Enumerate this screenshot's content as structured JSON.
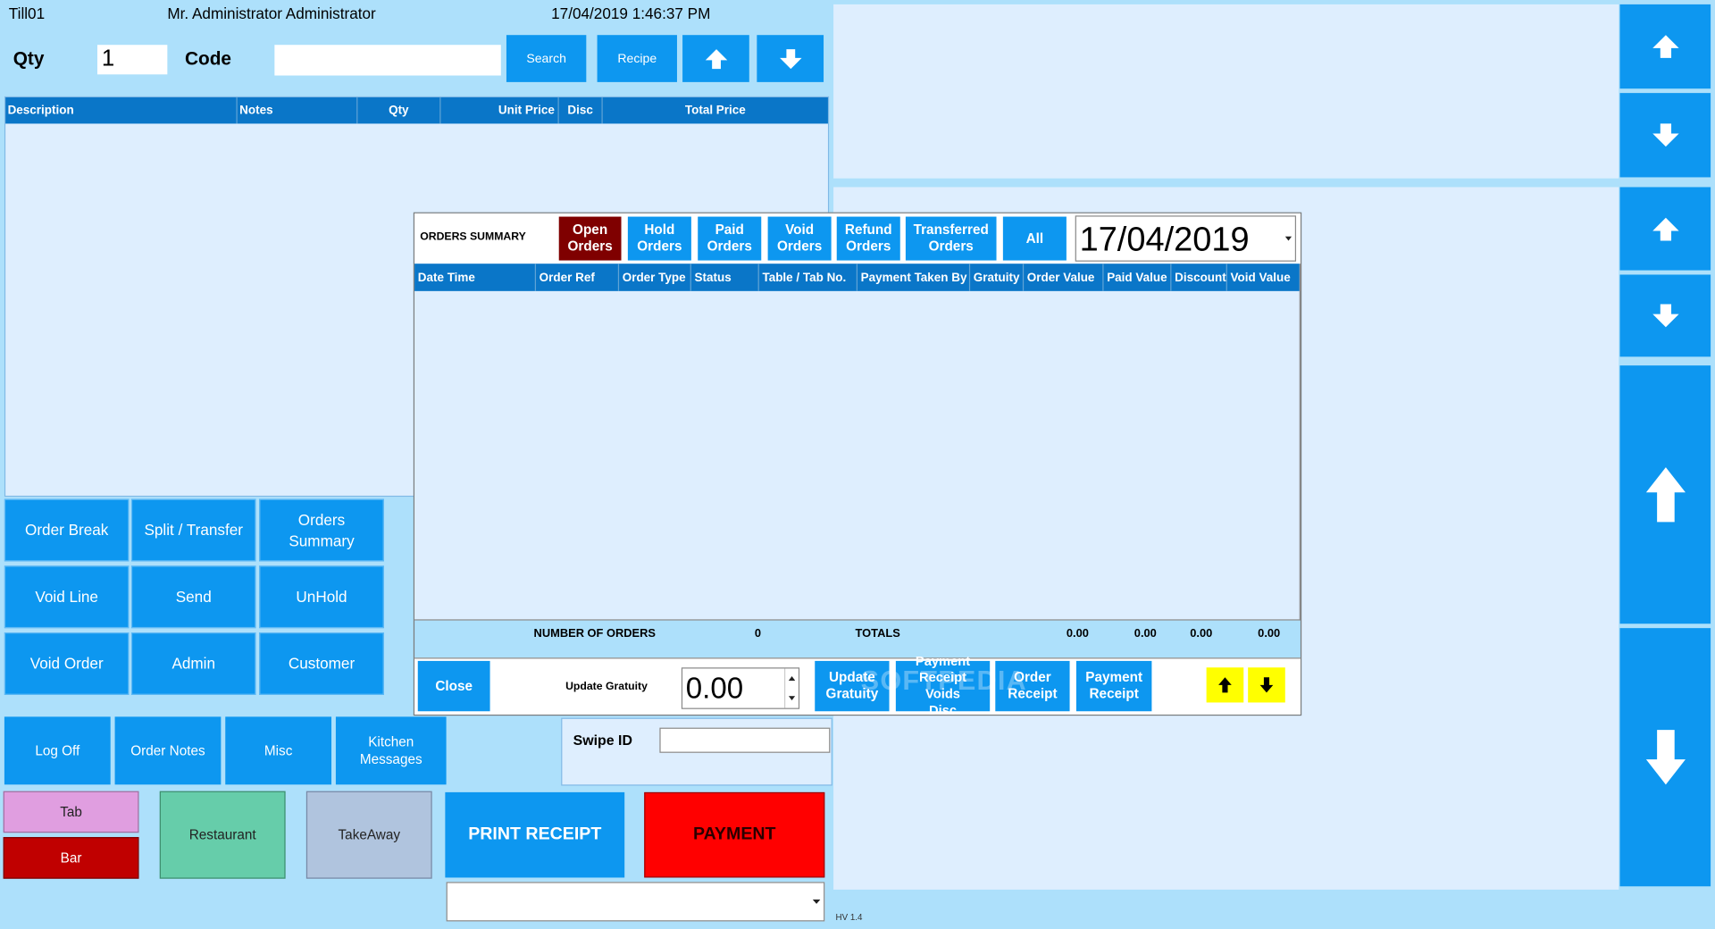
{
  "header": {
    "till": "Till01",
    "user": "Mr. Administrator Administrator",
    "datetime": "17/04/2019 1:46:37 PM"
  },
  "entry": {
    "qty_label": "Qty",
    "qty_value": "1",
    "code_label": "Code",
    "code_value": "",
    "search_label": "Search",
    "recipe_label": "Recipe"
  },
  "order_columns": [
    "Description",
    "Notes",
    "Qty",
    "Unit Price",
    "Disc",
    "Total Price"
  ],
  "function_buttons": {
    "order_break": "Order Break",
    "split_transfer": "Split / Transfer",
    "orders_summary": "Orders Summary",
    "void_line": "Void Line",
    "send": "Send",
    "unhold": "UnHold",
    "void_order": "Void Order",
    "admin": "Admin",
    "customer": "Customer"
  },
  "bottom_buttons": {
    "log_off": "Log Off",
    "order_notes": "Order Notes",
    "misc": "Misc",
    "kitchen_messages": "Kitchen Messages",
    "tab": "Tab",
    "bar": "Bar",
    "restaurant": "Restaurant",
    "takeaway": "TakeAway",
    "print_receipt": "PRINT RECEIPT",
    "payment": "PAYMENT"
  },
  "swipe": {
    "label": "Swipe ID",
    "value": ""
  },
  "bottom_select": {
    "value": ""
  },
  "version": "HV 1.4",
  "orders_summary": {
    "title": "ORDERS SUMMARY",
    "filters": [
      "Open Orders",
      "Hold Orders",
      "Paid Orders",
      "Void Orders",
      "Refund Orders",
      "Transferred Orders",
      "All"
    ],
    "active_filter": "Open Orders",
    "date": "17/04/2019",
    "columns": [
      "Date Time",
      "Order Ref",
      "Order Type",
      "Status",
      "Table / Tab No.",
      "Payment Taken By",
      "Gratuity",
      "Order Value",
      "Paid Value",
      "Discount",
      "Void Value"
    ],
    "rows": [],
    "number_of_orders_label": "NUMBER OF ORDERS",
    "number_of_orders": "0",
    "totals_label": "TOTALS",
    "totals": [
      "0.00",
      "0.00",
      "0.00",
      "0.00"
    ],
    "close_label": "Close",
    "update_gratuity_label": "Update Gratuity",
    "gratuity_value": "0.00",
    "update_gratuity_button": "Update Gratuity",
    "payment_receipt_voids_disc": "Payment Receipt Voids Disc",
    "order_receipt": "Order Receipt",
    "payment_receipt": "Payment Receipt",
    "watermark": "SOFTPEDIA"
  },
  "colors": {
    "background": "#ade0fb",
    "panel": "#deeefe",
    "button": "#0d97f0",
    "header": "#0a76c8",
    "active_filter": "#7f0000",
    "payment": "#ff0000",
    "tab": "#e09ee0",
    "bar": "#c00000",
    "restaurant": "#66cdaa",
    "takeaway": "#b0c4de",
    "nav_arrows": "#ffff00"
  },
  "icons": [
    "arrow-up-icon",
    "arrow-down-icon",
    "spin-up-icon",
    "spin-down-icon",
    "dropdown-arrow-icon"
  ]
}
